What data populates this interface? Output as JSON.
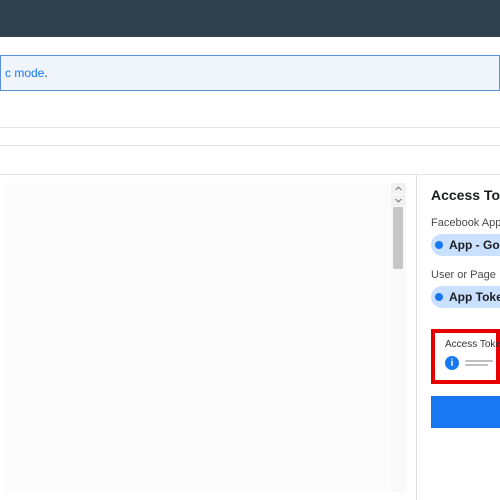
{
  "banner": {
    "prefix_text": "c mode",
    "suffix": "."
  },
  "sidebar": {
    "title": "Access Token",
    "app_label": "Facebook App",
    "app_value": "App - GoodBarber",
    "user_label": "User or Page",
    "user_value": "App Token",
    "token_label": "Access Token",
    "token_masked": "",
    "generate_label": ""
  },
  "icons": {
    "info": "i"
  }
}
